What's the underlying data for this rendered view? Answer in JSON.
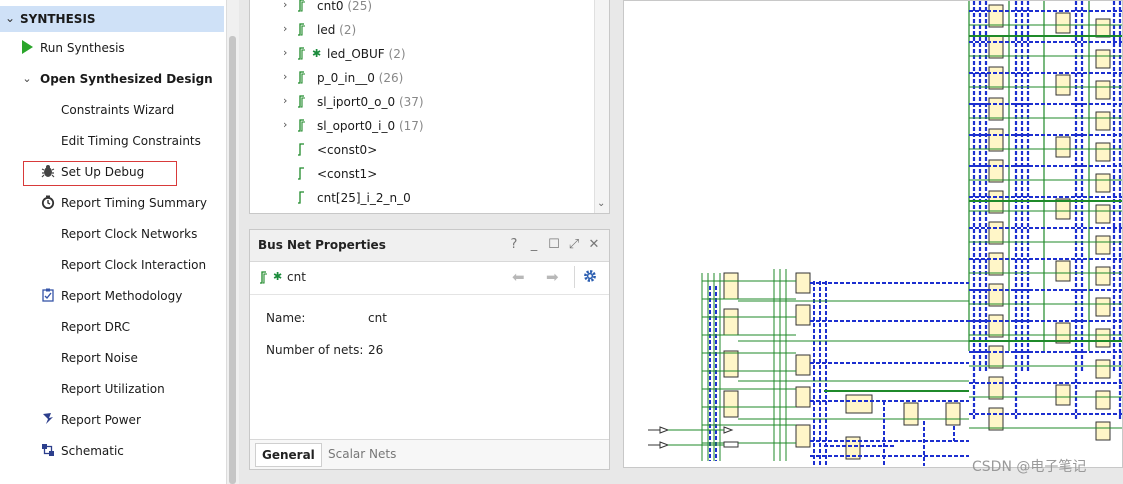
{
  "flow_navigator": {
    "section": "SYNTHESIS",
    "items": [
      {
        "label": "Run Synthesis",
        "icon": "play-icon"
      },
      {
        "label": "Open Synthesized Design",
        "icon": "chevron-down-icon"
      },
      {
        "label": "Constraints Wizard",
        "icon": ""
      },
      {
        "label": "Edit Timing Constraints",
        "icon": ""
      },
      {
        "label": "Set Up Debug",
        "icon": "bug-icon"
      },
      {
        "label": "Report Timing Summary",
        "icon": "clock-icon"
      },
      {
        "label": "Report Clock Networks",
        "icon": ""
      },
      {
        "label": "Report Clock Interaction",
        "icon": ""
      },
      {
        "label": "Report Methodology",
        "icon": "checklist-icon"
      },
      {
        "label": "Report DRC",
        "icon": ""
      },
      {
        "label": "Report Noise",
        "icon": ""
      },
      {
        "label": "Report Utilization",
        "icon": ""
      },
      {
        "label": "Report Power",
        "icon": "power-icon"
      },
      {
        "label": "Schematic",
        "icon": "schematic-icon"
      }
    ]
  },
  "netlist_tree": {
    "rows": [
      {
        "name": "cnt0",
        "count": "(25)",
        "expandable": true,
        "debug": false
      },
      {
        "name": "led",
        "count": "(2)",
        "expandable": true,
        "debug": false
      },
      {
        "name": "led_OBUF",
        "count": "(2)",
        "expandable": true,
        "debug": true
      },
      {
        "name": "p_0_in__0",
        "count": "(26)",
        "expandable": true,
        "debug": false
      },
      {
        "name": "sl_iport0_o_0",
        "count": "(37)",
        "expandable": true,
        "debug": false
      },
      {
        "name": "sl_oport0_i_0",
        "count": "(17)",
        "expandable": true,
        "debug": false
      },
      {
        "name": "<const0>",
        "count": "",
        "expandable": false,
        "debug": false
      },
      {
        "name": "<const1>",
        "count": "",
        "expandable": false,
        "debug": false
      },
      {
        "name": "cnt[25]_i_2_n_0",
        "count": "",
        "expandable": false,
        "debug": false
      }
    ]
  },
  "bus_net_properties": {
    "title": "Bus Net Properties",
    "header_buttons": [
      "?",
      "_",
      "☐",
      "⤢",
      "✕"
    ],
    "object_name": "cnt",
    "name_label": "Name:",
    "name_value": "cnt",
    "nets_label": "Number of nets:",
    "nets_value": "26",
    "tabs": [
      "General",
      "Scalar Nets"
    ],
    "active_tab": "General"
  },
  "watermark": "CSDN @电子笔记",
  "colors": {
    "accent": "#cfe1f7",
    "highlight_box": "#d83a3a",
    "net_green": "#1f8a2a",
    "net_blue": "#1c2fd0",
    "cell_fill": "#fff6c8"
  }
}
